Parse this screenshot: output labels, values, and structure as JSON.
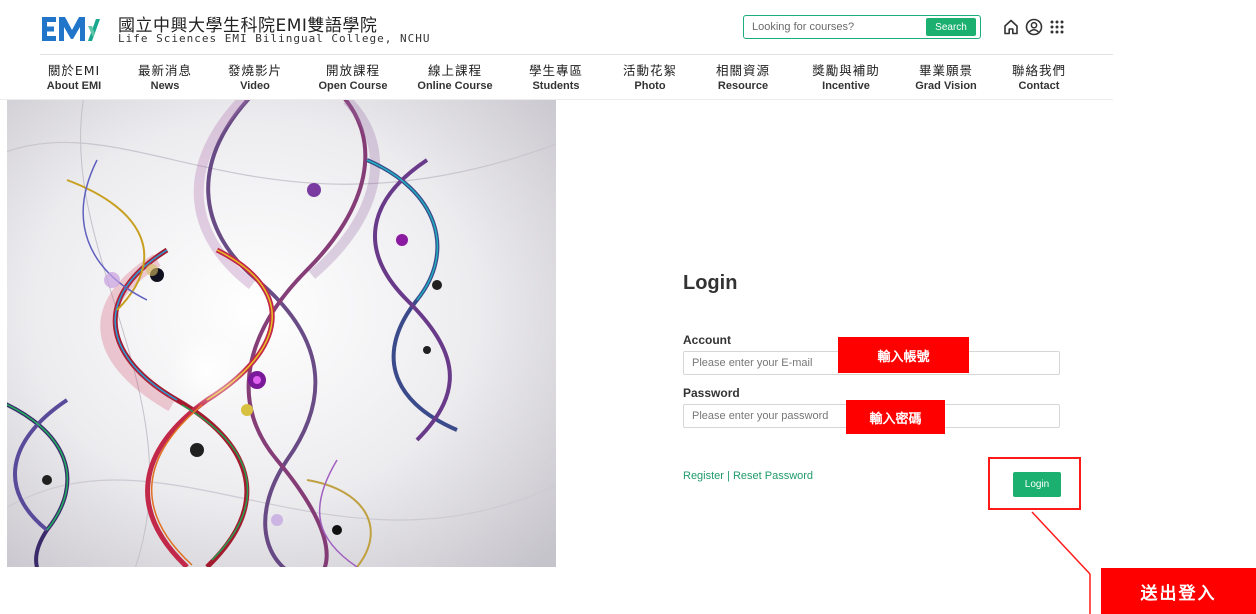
{
  "header": {
    "title_zh": "國立中興大學生科院EMI雙語學院",
    "title_en": "Life Sciences EMI Bilingual College, NCHU",
    "search": {
      "placeholder": "Looking for courses?",
      "button_label": "Search"
    },
    "icons": [
      "home-icon",
      "user-icon",
      "menu-dots-icon"
    ]
  },
  "nav": {
    "items": [
      {
        "zh": "關於EMI",
        "en": "About EMI"
      },
      {
        "zh": "最新消息",
        "en": "News"
      },
      {
        "zh": "發燒影片",
        "en": "Video"
      },
      {
        "zh": "開放課程",
        "en": "Open Course"
      },
      {
        "zh": "線上課程",
        "en": "Online Course"
      },
      {
        "zh": "學生專區",
        "en": "Students"
      },
      {
        "zh": "活動花絮",
        "en": "Photo"
      },
      {
        "zh": "相關資源",
        "en": "Resource"
      },
      {
        "zh": "獎勵與補助",
        "en": "Incentive"
      },
      {
        "zh": "畢業願景",
        "en": "Grad Vision"
      },
      {
        "zh": "聯絡我們",
        "en": "Contact"
      }
    ]
  },
  "login": {
    "title": "Login",
    "account_label": "Account",
    "account_placeholder": "Please enter your E-mail",
    "password_label": "Password",
    "password_placeholder": "Please enter your password",
    "register_link": "Register",
    "separator": "|",
    "reset_link": "Reset Password",
    "button_label": "Login"
  },
  "annotations": {
    "account_note": "輸入帳號",
    "password_note": "輸入密碼",
    "submit_note": "送出登入",
    "color": "#ff0000"
  },
  "colors": {
    "accent": "#1bb070",
    "logo_blue": "#2276c9",
    "logo_teal": "#19a78f"
  }
}
